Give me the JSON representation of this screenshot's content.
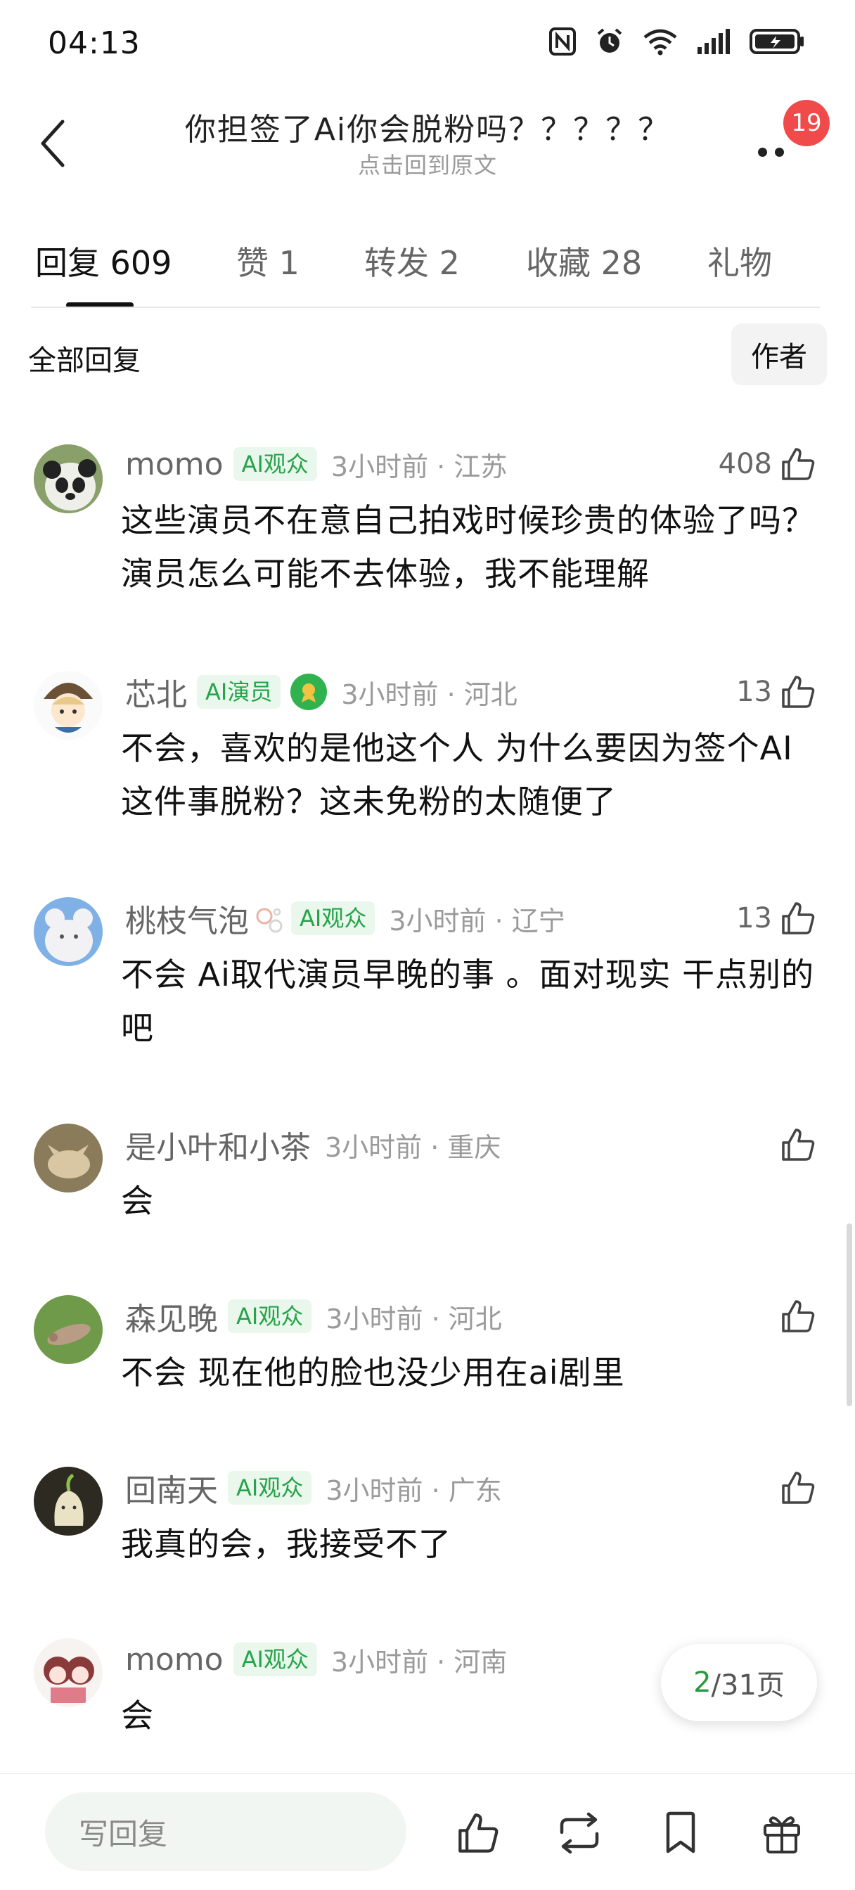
{
  "status_bar": {
    "time": "04:13"
  },
  "header": {
    "title": "你担签了Ai你会脱粉吗？？？？？",
    "subtitle": "点击回到原文",
    "badge_count": "19"
  },
  "tabs": [
    {
      "label": "回复 609"
    },
    {
      "label": "赞 1"
    },
    {
      "label": "转发 2"
    },
    {
      "label": "收藏 28"
    },
    {
      "label": "礼物"
    }
  ],
  "filter": {
    "label": "全部回复",
    "author_button": "作者"
  },
  "comments": [
    {
      "name": "momo",
      "tag": "AI观众",
      "time": "3小时前 · 江苏",
      "likes": "408",
      "text": "这些演员不在意自己拍戏时候珍贵的体验了吗？演员怎么可能不去体验，我不能理解"
    },
    {
      "name": "芯北",
      "tag": "AI演员",
      "time": "3小时前 · 河北",
      "likes": "13",
      "text": "不会，喜欢的是他这个人 为什么要因为签个AI这件事脱粉？这未免粉的太随便了"
    },
    {
      "name": "桃枝气泡",
      "tag": "AI观众",
      "time": "3小时前 · 辽宁",
      "likes": "13",
      "text": "不会 Ai取代演员早晚的事 。面对现实 干点别的吧"
    },
    {
      "name": "是小叶和小茶",
      "tag": "",
      "time": "3小时前 · 重庆",
      "likes": "",
      "text": "会"
    },
    {
      "name": "森见晚",
      "tag": "AI观众",
      "time": "3小时前 · 河北",
      "likes": "",
      "text": "不会 现在他的脸也没少用在ai剧里"
    },
    {
      "name": "回南天",
      "tag": "AI观众",
      "time": "3小时前 · 广东",
      "likes": "",
      "text": "我真的会，我接受不了"
    },
    {
      "name": "momo",
      "tag": "AI观众",
      "time": "3小时前 · 河南",
      "likes": "",
      "text": "会"
    }
  ],
  "pagination": {
    "current": "2",
    "total_text": "/31页"
  },
  "bottom_bar": {
    "reply_placeholder": "写回复"
  },
  "colors": {
    "accent_green": "#27a34a",
    "badge_red": "#f04a4a"
  },
  "icons": [
    "back-arrow-icon",
    "more-icon",
    "thumbs-up-icon",
    "repost-icon",
    "bookmark-icon",
    "gift-icon"
  ]
}
